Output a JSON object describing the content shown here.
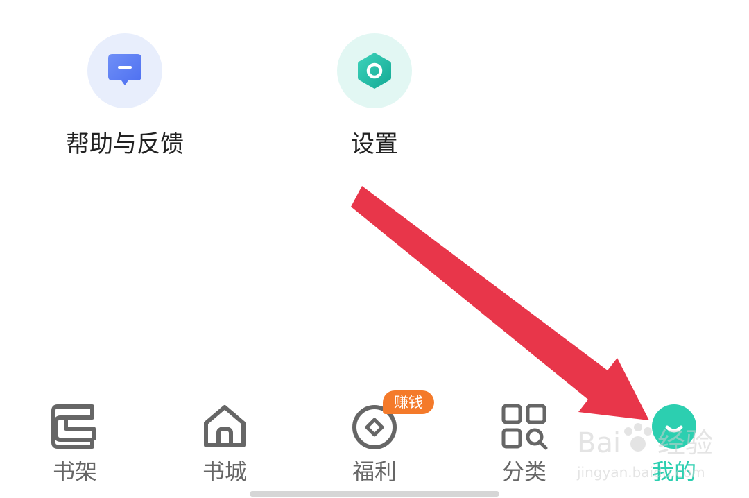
{
  "shortcuts": {
    "help": {
      "label": "帮助与反馈",
      "icon": "message-icon"
    },
    "settings": {
      "label": "设置",
      "icon": "settings-hexagon-icon"
    }
  },
  "tabbar": {
    "active_color": "#2ccfb0",
    "inactive_color": "#666666",
    "items": [
      {
        "label": "书架",
        "icon": "bookshelf-icon"
      },
      {
        "label": "书城",
        "icon": "home-icon"
      },
      {
        "label": "福利",
        "icon": "coin-icon",
        "badge": "赚钱"
      },
      {
        "label": "分类",
        "icon": "category-grid-icon"
      },
      {
        "label": "我的",
        "icon": "smiley-face-icon",
        "active": true
      }
    ]
  },
  "annotation": {
    "arrow_color": "#e8364a"
  },
  "watermark": {
    "text": "Baidu经验",
    "url_text": "jingyan.baidu.com"
  }
}
